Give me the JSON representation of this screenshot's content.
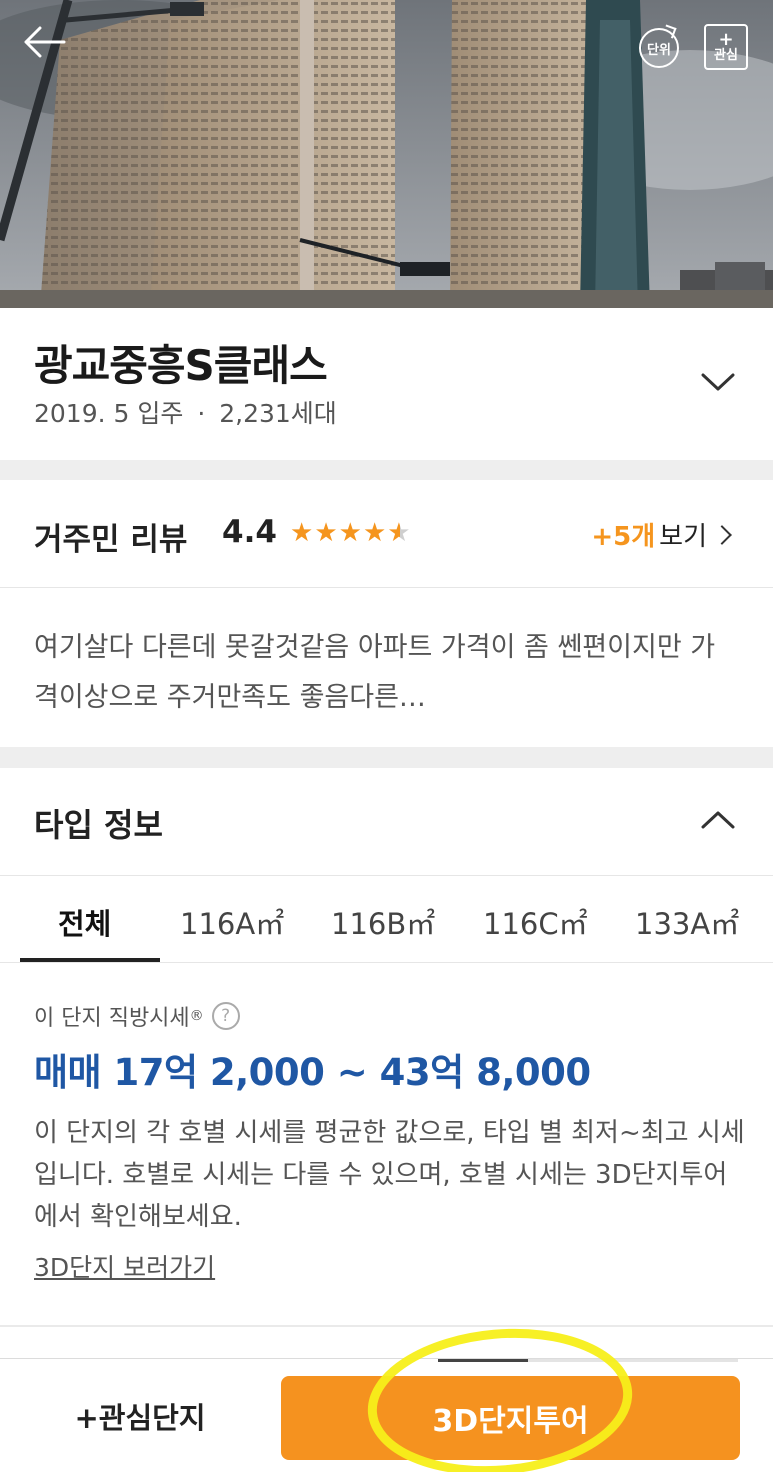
{
  "header": {
    "unit_label": "단위",
    "favorite_plus": "+",
    "favorite_label": "관심"
  },
  "complex": {
    "name": "광교중흥S클래스",
    "move_in": "2019. 5 입주",
    "separator": "·",
    "households": "2,231세대"
  },
  "review": {
    "title": "거주민 리뷰",
    "rating": "4.4",
    "stars_filled": 4.4,
    "more_count": "+5개",
    "more_label": "보기",
    "excerpt": "여기살다 다른데 못갈것같음   아파트 가격이 좀 쎈편이지만  가격이상으로 주거만족도 좋음다른…"
  },
  "type_info": {
    "title": "타입 정보",
    "tabs": [
      "전체",
      "116A㎡",
      "116B㎡",
      "116C㎡",
      "133A㎡"
    ],
    "active_tab": "전체"
  },
  "price": {
    "label": "이 단지 직방시세",
    "label_mark": "®",
    "help": "?",
    "value": "매매 17억 2,000 ~ 43억 8,000",
    "description": "이 단지의 각 호별 시세를 평균한 값으로, 타입 별 최저~최고 시세입니다. 호별로 시세는 다를 수 있으며, 호별 시세는 3D단지투어에서 확인해보세요.",
    "link": "3D단지 보러가기"
  },
  "bottom_bar": {
    "favorite_complex": "+관심단지",
    "tour_button": "3D단지투어"
  },
  "colors": {
    "accent_orange": "#f5921f",
    "price_blue": "#1f57a4",
    "highlight_yellow": "#f7ef1a"
  }
}
